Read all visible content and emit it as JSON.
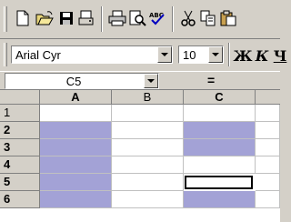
{
  "toolbar_standard": {
    "buttons": [
      {
        "name": "new-document-icon"
      },
      {
        "name": "open-folder-icon"
      },
      {
        "name": "save-icon"
      },
      {
        "name": "document-icon"
      },
      {
        "name": "print-icon"
      },
      {
        "name": "print-preview-icon"
      },
      {
        "name": "spelling-icon",
        "label": "ABC"
      },
      {
        "name": "cut-icon"
      },
      {
        "name": "copy-icon"
      },
      {
        "name": "paste-icon"
      }
    ]
  },
  "toolbar_formatting": {
    "font_name": "Arial Cyr",
    "font_size": "10",
    "bold_label": "Ж",
    "italic_label": "К",
    "underline_label": "Ч"
  },
  "formula_bar": {
    "name_box": "C5",
    "equals": "="
  },
  "grid": {
    "columns": [
      "A",
      "B",
      "C"
    ],
    "selected_columns": [
      "A",
      "C"
    ],
    "rows": [
      "1",
      "2",
      "3",
      "4",
      "5",
      "6"
    ],
    "selected_rows": [
      "2",
      "3",
      "4",
      "5",
      "6"
    ],
    "highlighted_cells": [
      "A2",
      "A3",
      "A4",
      "A5",
      "A6",
      "C2",
      "C3",
      "C6"
    ],
    "active_cell": "C5",
    "colors": {
      "selection": "#a3a2d6"
    }
  }
}
